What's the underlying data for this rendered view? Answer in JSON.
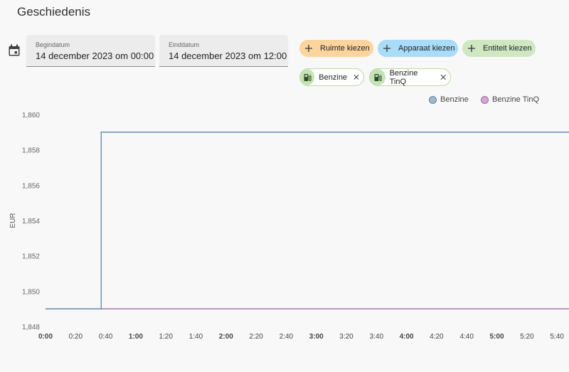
{
  "page": {
    "title": "Geschiedenis"
  },
  "date_range": {
    "start": {
      "label": "Begindatum",
      "value": "14 december 2023 om 00:00"
    },
    "end": {
      "label": "Einddatum",
      "value": "14 december 2023 om 12:00"
    }
  },
  "target_buttons": [
    {
      "label": "Ruimte kiezen",
      "color": "#fcd49e"
    },
    {
      "label": "Apparaat kiezen",
      "color": "#a9dcf8"
    },
    {
      "label": "Entiteit kiezen",
      "color": "#cfe8c1"
    }
  ],
  "entities": [
    {
      "label": "Benzine",
      "icon": "gas-station-icon"
    },
    {
      "label": "Benzine TinQ",
      "icon": "gas-station-icon"
    }
  ],
  "colors": {
    "series_1": "#5b86ad",
    "series_2": "#a46aa2",
    "chip_accent": "#c6e3b4"
  },
  "chart_data": {
    "type": "line",
    "step": true,
    "ylabel": "EUR",
    "ylim": [
      1.848,
      1.86
    ],
    "y_ticks": [
      "1,848",
      "1,850",
      "1,852",
      "1,854",
      "1,856",
      "1,858",
      "1,860"
    ],
    "x_ticks": [
      {
        "label": "0:00",
        "bold": true
      },
      {
        "label": "0:20",
        "bold": false
      },
      {
        "label": "0:40",
        "bold": false
      },
      {
        "label": "1:00",
        "bold": true
      },
      {
        "label": "1:20",
        "bold": false
      },
      {
        "label": "1:40",
        "bold": false
      },
      {
        "label": "2:00",
        "bold": true
      },
      {
        "label": "2:20",
        "bold": false
      },
      {
        "label": "2:40",
        "bold": false
      },
      {
        "label": "3:00",
        "bold": true
      },
      {
        "label": "3:20",
        "bold": false
      },
      {
        "label": "3:40",
        "bold": false
      },
      {
        "label": "4:00",
        "bold": true
      },
      {
        "label": "4:20",
        "bold": false
      },
      {
        "label": "4:40",
        "bold": false
      },
      {
        "label": "5:00",
        "bold": true
      },
      {
        "label": "5:20",
        "bold": false
      },
      {
        "label": "5:40",
        "bold": false
      }
    ],
    "legend_position": "top-right",
    "grid": false,
    "series": [
      {
        "name": "Benzine",
        "color": "#5b86ad",
        "points": [
          {
            "x": 0,
            "y": 1.849
          },
          {
            "x": 37,
            "y": 1.849
          },
          {
            "x": 37,
            "y": 1.859
          },
          {
            "x": 349,
            "y": 1.859
          }
        ]
      },
      {
        "name": "Benzine TinQ",
        "color": "#a46aa2",
        "points": [
          {
            "x": 0,
            "y": 1.849
          },
          {
            "x": 349,
            "y": 1.849
          }
        ]
      }
    ]
  }
}
